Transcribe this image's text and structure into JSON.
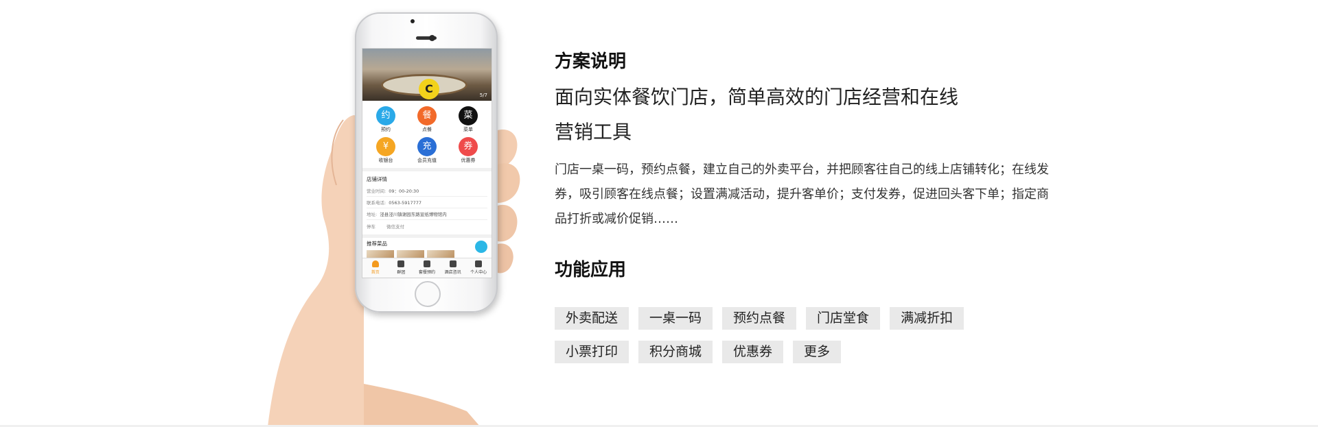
{
  "phone": {
    "hero_page_indicator": "5/7",
    "icons": [
      {
        "label": "预约",
        "glyph": "约",
        "color": "#2aa9e8",
        "icon": "calendar-icon"
      },
      {
        "label": "点餐",
        "glyph": "餐",
        "color": "#f26a2a",
        "icon": "dish-icon"
      },
      {
        "label": "菜单",
        "glyph": "菜",
        "color": "#111111",
        "icon": "menu-icon"
      },
      {
        "label": "收银台",
        "glyph": "¥",
        "color": "#f5a623",
        "icon": "cashier-icon"
      },
      {
        "label": "会员充值",
        "glyph": "充",
        "color": "#2a6fd6",
        "icon": "topup-icon"
      },
      {
        "label": "优惠券",
        "glyph": "券",
        "color": "#ef4b4b",
        "icon": "coupon-icon"
      }
    ],
    "store_section_title": "店铺详情",
    "hours_label": "营业时间:",
    "hours_value": "09：00-20:30",
    "phone_label": "联系电话:",
    "phone_value": "0563-5917777",
    "address_label": "地址:",
    "address_value": "泾县泾川镇谢园东路宣纸博物馆内",
    "chip_parking": "停车",
    "chip_wechat_pay": "微信支付",
    "recommend_title": "推荐菜品",
    "tabs": [
      {
        "label": "首页",
        "active": true
      },
      {
        "label": "群团",
        "active": false
      },
      {
        "label": "套餐预约",
        "active": false
      },
      {
        "label": "酒店咨讯",
        "active": false
      },
      {
        "label": "个人中心",
        "active": false
      }
    ]
  },
  "solution": {
    "title": "方案说明",
    "subtitle_line1": "面向实体餐饮门店，简单高效的门店经营和在线",
    "subtitle_line2": "营销工具",
    "description": "门店一桌一码，预约点餐，建立自己的外卖平台，并把顾客往自己的线上店铺转化；在线发券，吸引顾客在线点餐；设置满减活动，提升客单价；支付发券，促进回头客下单；指定商品打折或减价促销……"
  },
  "features": {
    "title": "功能应用",
    "tags": [
      "外卖配送",
      "一桌一码",
      "预约点餐",
      "门店堂食",
      "满减折扣",
      "小票打印",
      "积分商城",
      "优惠券",
      "更多"
    ]
  }
}
